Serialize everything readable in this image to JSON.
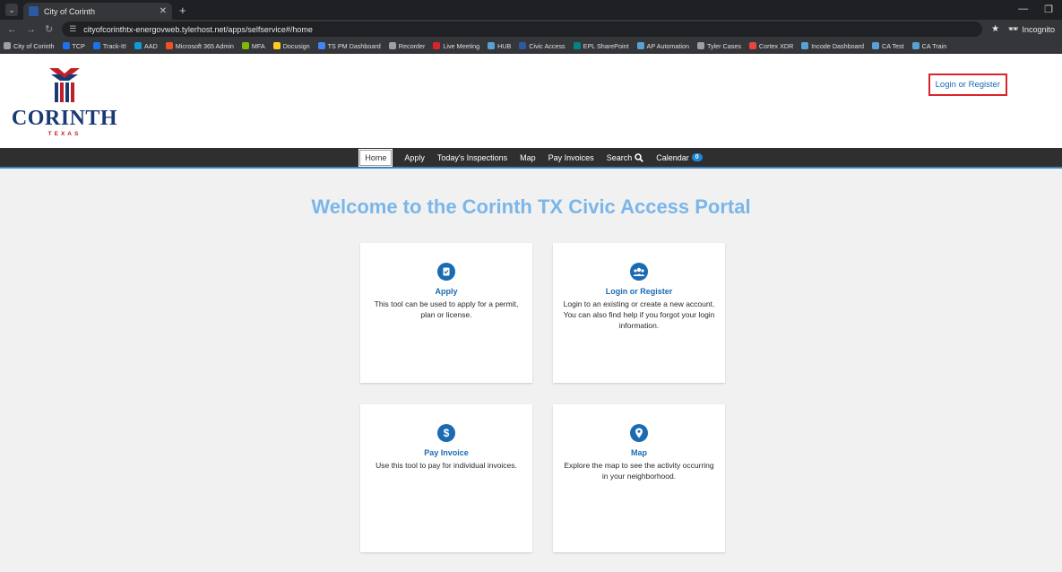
{
  "browser": {
    "tab_title": "City of Corinth",
    "url": "cityofcorinthtx-energovweb.tylerhost.net/apps/selfservice#/home",
    "incognito_label": "Incognito",
    "bookmarks": [
      {
        "label": "City of Corinth",
        "color": "#9aa0a6"
      },
      {
        "label": "TCP",
        "color": "#1a73e8"
      },
      {
        "label": "Track-It!",
        "color": "#1a73e8"
      },
      {
        "label": "AAD",
        "color": "#0f9bd7"
      },
      {
        "label": "Microsoft 365 Admin",
        "color": "#f25022"
      },
      {
        "label": "MFA",
        "color": "#7fba00"
      },
      {
        "label": "Docusign",
        "color": "#ffcc22"
      },
      {
        "label": "TS PM Dashboard",
        "color": "#4285f4"
      },
      {
        "label": "Recorder",
        "color": "#9aa0a6"
      },
      {
        "label": "Live Meeting",
        "color": "#d9242b"
      },
      {
        "label": "HUB",
        "color": "#5aa0d6"
      },
      {
        "label": "Civic Access",
        "color": "#2c5aa0"
      },
      {
        "label": "EPL SharePoint",
        "color": "#038387"
      },
      {
        "label": "AP Automation",
        "color": "#5aa0d6"
      },
      {
        "label": "Tyler Cases",
        "color": "#9aa0a6"
      },
      {
        "label": "Cortex XDR",
        "color": "#e8453c"
      },
      {
        "label": "Incode Dashboard",
        "color": "#5aa0d6"
      },
      {
        "label": "CA Test",
        "color": "#5aa0d6"
      },
      {
        "label": "CA Train",
        "color": "#5aa0d6"
      }
    ]
  },
  "header": {
    "logo_name": "CORINTH",
    "logo_sub": "TEXAS",
    "login_link": "Login or Register"
  },
  "nav": {
    "items": [
      "Home",
      "Apply",
      "Today's Inspections",
      "Map",
      "Pay Invoices",
      "Search",
      "Calendar"
    ],
    "calendar_badge": "0"
  },
  "main": {
    "welcome": "Welcome to the Corinth TX Civic Access Portal",
    "cards": [
      {
        "title": "Apply",
        "desc": "This tool can be used to apply for a permit, plan or license.",
        "icon": "clipboard-check-icon"
      },
      {
        "title": "Login or Register",
        "desc": "Login to an existing or create a new account. You can also find help if you forgot your login information.",
        "icon": "users-icon"
      },
      {
        "title": "Pay Invoice",
        "desc": "Use this tool to pay for individual invoices.",
        "icon": "dollar-icon"
      },
      {
        "title": "Map",
        "desc": "Explore the map to see the activity occurring in your neighborhood.",
        "icon": "map-pin-icon"
      }
    ]
  },
  "colors": {
    "accent": "#1b6bb3",
    "welcome": "#7ab6ea",
    "navbar": "#2f2f2f",
    "highlight": "#d9242b"
  }
}
